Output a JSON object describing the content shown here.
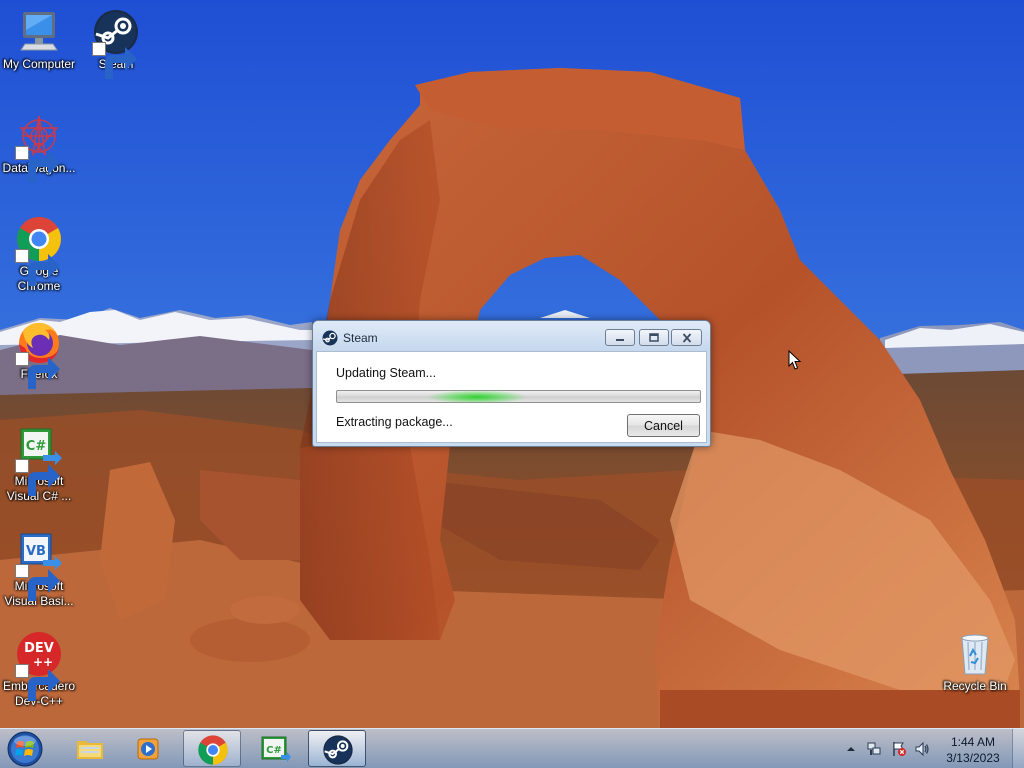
{
  "desktop": {
    "icons": [
      {
        "label": "My Computer",
        "icon": "computer-icon"
      },
      {
        "label": "Steam",
        "icon": "steam-icon"
      },
      {
        "label": "DataWagon...",
        "icon": "datawagon-icon"
      },
      {
        "label": "Google Chrome",
        "icon": "chrome-icon"
      },
      {
        "label": "Firefox",
        "icon": "firefox-icon"
      },
      {
        "label": "Microsoft Visual C# ...",
        "icon": "visual-csharp-icon"
      },
      {
        "label": "Microsoft Visual Basi...",
        "icon": "visual-basic-icon"
      },
      {
        "label": "Embarcadero Dev-C++",
        "icon": "dev-cpp-icon"
      },
      {
        "label": "Recycle Bin",
        "icon": "recycle-bin-icon"
      }
    ]
  },
  "dialog": {
    "title": "Steam",
    "status": "Updating Steam...",
    "detail": "Extracting package...",
    "cancel_label": "Cancel",
    "progress_state": "indeterminate"
  },
  "taskbar": {
    "pinned": [
      {
        "icon": "start-orb-icon"
      },
      {
        "icon": "folder-icon"
      },
      {
        "icon": "media-player-icon"
      },
      {
        "icon": "chrome-icon",
        "state": "open"
      },
      {
        "icon": "visual-csharp-icon"
      },
      {
        "icon": "steam-icon",
        "state": "active"
      }
    ],
    "tray": {
      "icons": [
        "show-hidden-icons-icon",
        "network-icon",
        "action-center-icon",
        "volume-icon"
      ],
      "time": "1:44 AM",
      "date": "3/13/2023"
    }
  },
  "colors": {
    "sky": "#2f62d8",
    "rock": "#b8542a",
    "dialog_frame": "#c8dbef",
    "progress_glow": "#2fd22f",
    "taskbar": "#9fbfe0"
  }
}
